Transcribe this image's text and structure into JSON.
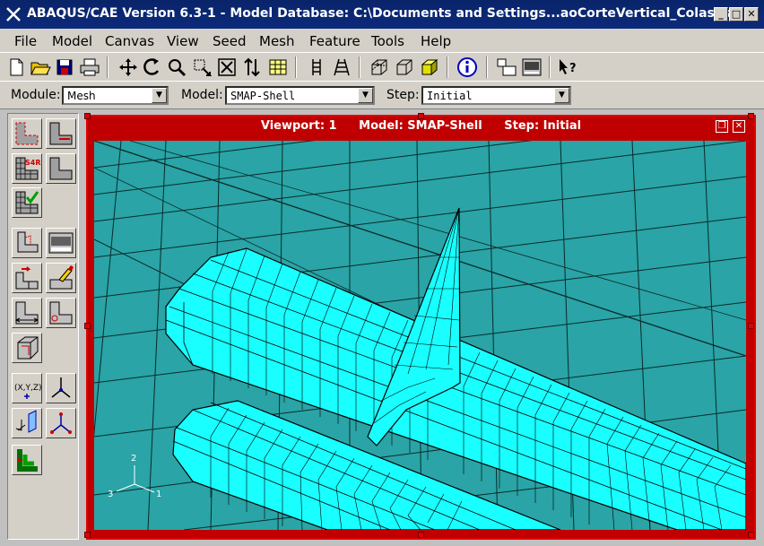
{
  "window": {
    "title": "ABAQUS/CAE Version 6.3-1 - Model Database: C:\\Documents and Settings...aoCorteVertical_Colas.cae",
    "minimize_label": "_",
    "maximize_label": "□",
    "close_label": "✕"
  },
  "menu": {
    "items": [
      {
        "label": "File"
      },
      {
        "label": "Model"
      },
      {
        "label": "Canvas"
      },
      {
        "label": "View"
      },
      {
        "label": "Seed"
      },
      {
        "label": "Mesh"
      },
      {
        "label": "Feature"
      },
      {
        "label": "Tools"
      },
      {
        "label": "Help"
      }
    ]
  },
  "toolbar": {
    "icons": [
      "new-file-icon",
      "open-folder-icon",
      "save-icon",
      "print-icon",
      "pan-icon",
      "rotate-icon",
      "zoom-icon",
      "box-zoom-icon",
      "fit-view-icon",
      "cycle-views-icon",
      "table-icon",
      "render-wireframe-icon",
      "render-hidden-icon",
      "iso-view-icon",
      "front-view-icon",
      "shaded-view-icon",
      "info-icon",
      "viewport-layout-icon",
      "viewport-window-icon",
      "whats-this-icon"
    ]
  },
  "context": {
    "module_label": "Module:",
    "module_value": "Mesh",
    "model_label": "Model:",
    "model_value": "SMAP-Shell",
    "step_label": "Step:",
    "step_value": "Initial"
  },
  "viewport": {
    "viewport_label": "Viewport: 1",
    "model_label": "Model: SMAP-Shell",
    "step_label": "Step: Initial",
    "triad": {
      "axis_x": "1",
      "axis_y": "2",
      "axis_z": "3"
    }
  },
  "toolbox": {
    "xyz_label": "(X,Y,Z)",
    "s4r_label": "S4R"
  },
  "colors": {
    "titlebar": "#0a246a",
    "viewport_border": "#c00000",
    "canvas_bg": "#2aa4a6",
    "mesh_fill": "#19ffff",
    "mesh_line": "#000000"
  }
}
